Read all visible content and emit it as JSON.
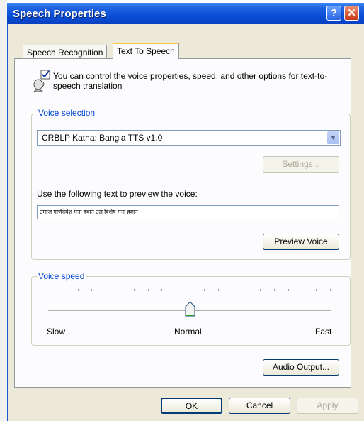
{
  "window": {
    "title": "Speech Properties"
  },
  "tabs": [
    {
      "label": "Speech Recognition",
      "active": false
    },
    {
      "label": "Text To Speech",
      "active": true
    }
  ],
  "description": "You can control the voice properties, speed, and other options for text-to-speech translation",
  "voice_selection": {
    "group_label": "Voice selection",
    "selected_voice": "CRBLP Katha: Bangla TTS v1.0",
    "settings_button": "Settings...",
    "preview_label": "Use the following text to preview the voice:",
    "preview_text": "उमाज गणिदेवेश  मना हवान उल्  विशेष   मना हवान",
    "preview_button": "Preview Voice"
  },
  "voice_speed": {
    "group_label": "Voice speed",
    "slow_label": "Slow",
    "normal_label": "Normal",
    "fast_label": "Fast",
    "level_fraction": 0.5,
    "tick_count": 20
  },
  "audio_output_button": "Audio Output...",
  "dialog_buttons": {
    "ok": "OK",
    "cancel": "Cancel",
    "apply": "Apply"
  },
  "colors": {
    "titlebar": "#0a4fd8",
    "group_label": "#0046d5",
    "tab_highlight": "#ffc83c"
  },
  "icons": {
    "help": "question-icon",
    "close": "close-x-icon",
    "speech": "speaking-head-icon"
  }
}
